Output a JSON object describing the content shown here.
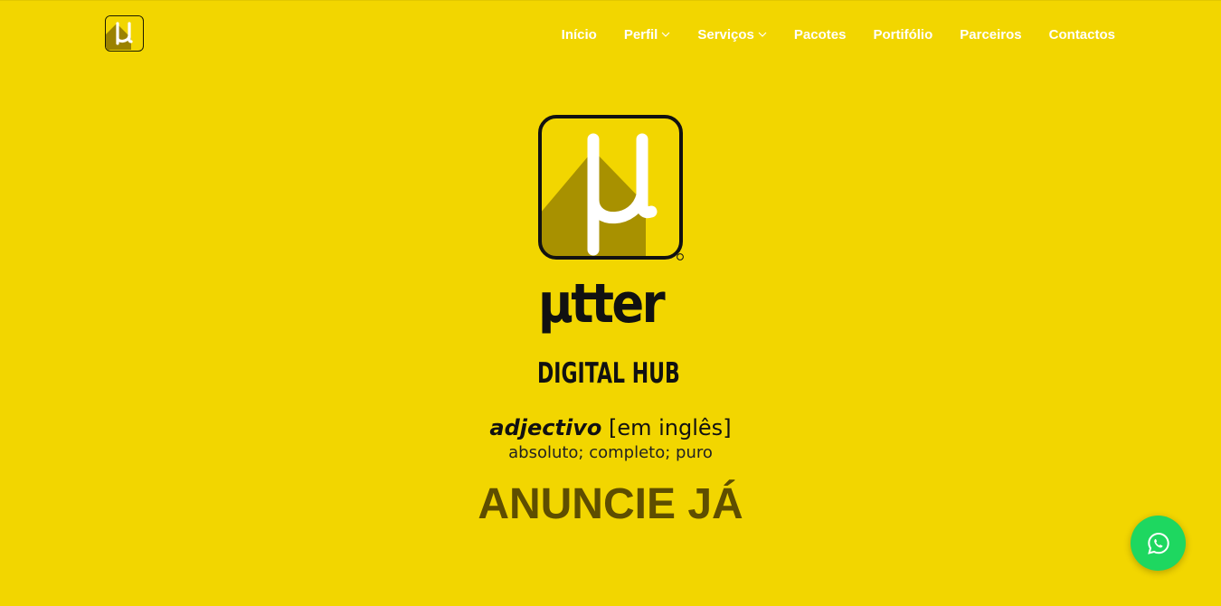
{
  "nav": {
    "logo_icon": "mu-logo-icon",
    "items": [
      {
        "label": "Início",
        "dropdown": false
      },
      {
        "label": "Perfil",
        "dropdown": true
      },
      {
        "label": "Serviços",
        "dropdown": true
      },
      {
        "label": "Pacotes",
        "dropdown": false
      },
      {
        "label": "Portifólio",
        "dropdown": false
      },
      {
        "label": "Parceiros",
        "dropdown": false
      },
      {
        "label": "Contactos",
        "dropdown": false
      }
    ]
  },
  "hero": {
    "logo_icon": "mu-logo-icon",
    "brand_name": "µtter",
    "brand_tagline": "DIGITAL HUB",
    "definition_term": "adjectivo",
    "definition_lang": "[em inglês]",
    "definition_meaning": "absoluto; completo; puro",
    "cta_label": "ANUNCIE JÁ"
  },
  "floating": {
    "icon": "whatsapp-icon"
  },
  "colors": {
    "background": "#f2d600",
    "nav_text": "#ffffff",
    "cta_text": "#5e4e00",
    "whatsapp_green": "#1ed760"
  }
}
